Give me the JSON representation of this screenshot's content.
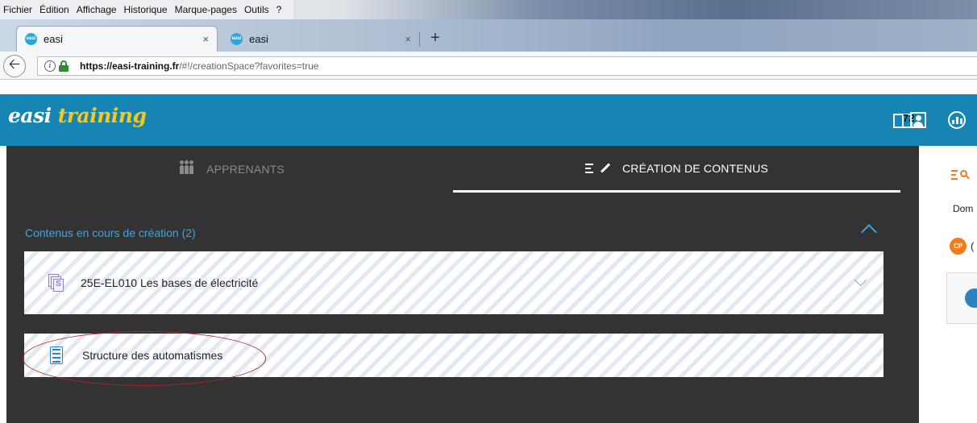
{
  "browser": {
    "menu": [
      {
        "label": "Fichier"
      },
      {
        "label": "Édition"
      },
      {
        "label": "Affichage"
      },
      {
        "label": "Historique"
      },
      {
        "label": "Marque-pages"
      },
      {
        "label": "Outils"
      },
      {
        "label": "?"
      }
    ],
    "tabs": [
      {
        "title": "easi",
        "favicon": "easi",
        "close": "×"
      },
      {
        "title": "easi",
        "favicon": "easi",
        "close": "×"
      }
    ],
    "new_tab": "+",
    "url_domain": "https://easi-training.fr",
    "url_path": "/#!/creationSpace?favorites=true"
  },
  "app": {
    "logo_part1": "easi",
    "logo_part2": "training",
    "notification_count": "72",
    "nav": {
      "learners": "APPRENANTS",
      "creation": "CRÉATION DE CONTENUS"
    },
    "section_title": "Contenus en cours de création (2)",
    "contents": [
      {
        "title": "25E-EL010 Les bases de électricité",
        "icon": "scorm-package-icon",
        "icon_letter": "S"
      },
      {
        "title": "Structure des automatismes",
        "icon": "document-list-icon"
      }
    ],
    "right_panel": {
      "domain_label": "Dom",
      "badge_text": "CP",
      "cut_text": "("
    }
  },
  "colors": {
    "header_blue": "#1685b3",
    "panel_dark": "#333333",
    "section_blue": "#3ca7e0",
    "logo_yellow": "#f7c81b",
    "accent_orange": "#f07d18",
    "annotation_red": "#a8282b"
  }
}
